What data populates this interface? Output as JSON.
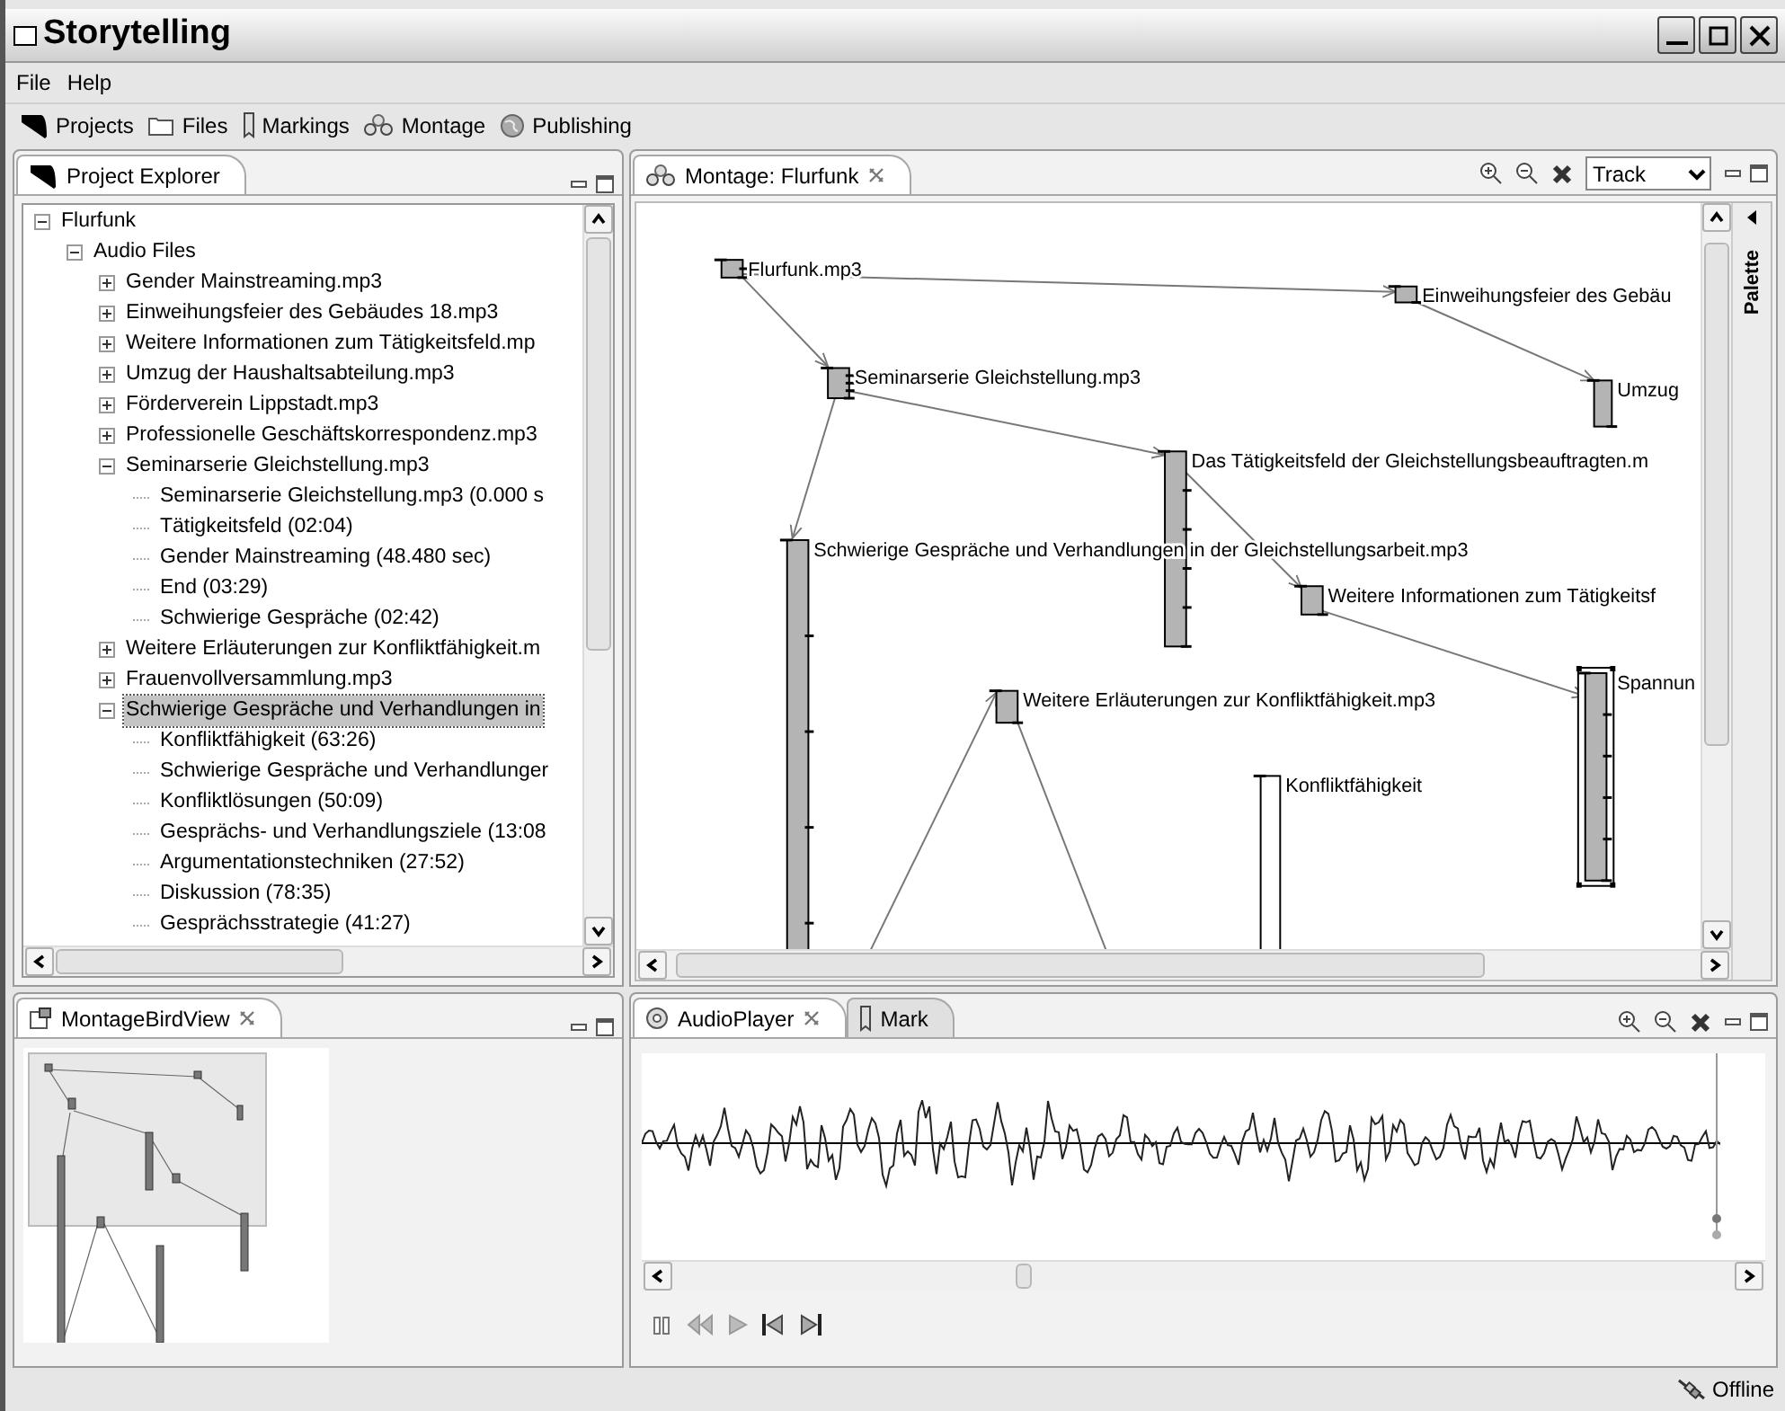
{
  "window": {
    "title": "Storytelling"
  },
  "menu": [
    "File",
    "Help"
  ],
  "toolbar": [
    {
      "label": "Projects",
      "kind": "projects"
    },
    {
      "label": "Files",
      "kind": "files"
    },
    {
      "label": "Markings",
      "kind": "markings"
    },
    {
      "label": "Montage",
      "kind": "montage"
    },
    {
      "label": "Publishing",
      "kind": "publishing"
    }
  ],
  "project_explorer": {
    "tab": {
      "label": "Project Explorer",
      "selected": true
    },
    "tree": [
      {
        "label": "Flurfunk",
        "expanded": true,
        "selected": false,
        "children": [
          {
            "label": "Audio Files",
            "expanded": true,
            "selected": false,
            "children": [
              {
                "label": "Gender Mainstreaming.mp3",
                "expanded": false,
                "selected": false
              },
              {
                "label": "Einweihungsfeier des Gebäudes 18.mp3",
                "expanded": false,
                "selected": false
              },
              {
                "label": "Weitere Informationen zum Tätigkeitsfeld.mp",
                "expanded": false,
                "selected": false
              },
              {
                "label": "Umzug der Haushaltsabteilung.mp3",
                "expanded": false,
                "selected": false
              },
              {
                "label": "Förderverein Lippstadt.mp3",
                "expanded": false,
                "selected": false
              },
              {
                "label": "Professionelle Geschäftskorrespondenz.mp3",
                "expanded": false,
                "selected": false
              },
              {
                "label": "Seminarserie Gleichstellung.mp3",
                "expanded": true,
                "selected": false,
                "children": [
                  {
                    "label": "Seminarserie Gleichstellung.mp3 (0.000 s",
                    "selected": false
                  },
                  {
                    "label": "Tätigkeitsfeld (02:04)",
                    "selected": false
                  },
                  {
                    "label": "Gender Mainstreaming (48.480 sec)",
                    "selected": false
                  },
                  {
                    "label": "End (03:29)",
                    "selected": false
                  },
                  {
                    "label": "Schwierige Gespräche (02:42)",
                    "selected": false
                  }
                ]
              },
              {
                "label": "Weitere Erläuterungen zur Konfliktfähigkeit.m",
                "expanded": false,
                "selected": false
              },
              {
                "label": "Frauenvollversammlung.mp3",
                "expanded": false,
                "selected": false
              },
              {
                "label": "Schwierige Gespräche und Verhandlungen in",
                "expanded": true,
                "selected": true,
                "children": [
                  {
                    "label": "Konfliktfähigkeit (63:26)",
                    "selected": false
                  },
                  {
                    "label": "Schwierige Gespräche und Verhandlunger",
                    "selected": false
                  },
                  {
                    "label": "Konfliktlösungen (50:09)",
                    "selected": false
                  },
                  {
                    "label": "Gesprächs- und Verhandlungsziele (13:08",
                    "selected": false
                  },
                  {
                    "label": "Argumentationstechniken (27:52)",
                    "selected": false
                  },
                  {
                    "label": "Diskussion (78:35)",
                    "selected": false
                  },
                  {
                    "label": "Gesprächsstrategie (41:27)",
                    "selected": false
                  }
                ]
              }
            ]
          }
        ]
      }
    ]
  },
  "montage": {
    "tab": {
      "label": "Montage: Flurfunk",
      "selected": true
    },
    "view_mode": "Track",
    "palette": "Palette",
    "nodes": [
      {
        "label": "Flurfunk.mp3",
        "kind": "audio",
        "selected": false
      },
      {
        "label": "Einweihungsfeier des Gebäu",
        "kind": "audio",
        "selected": false
      },
      {
        "label": "Seminarserie Gleichstellung.mp3",
        "kind": "audio",
        "selected": false
      },
      {
        "label": "Umzug",
        "kind": "audio",
        "selected": false
      },
      {
        "label": "Das Tätigkeitsfeld der Gleichstellungsbeauftragten.m",
        "kind": "audio",
        "selected": false
      },
      {
        "label": "Schwierige Gespräche und Verhandlungen in der Gleichstellungsarbeit.mp3",
        "kind": "audio",
        "selected": false
      },
      {
        "label": "Weitere Informationen zum Tätigkeitsf",
        "kind": "audio",
        "selected": false
      },
      {
        "label": "Spannun",
        "kind": "audio",
        "selected": true
      },
      {
        "label": "Weitere Erläuterungen zur Konfliktfähigkeit.mp3",
        "kind": "audio",
        "selected": false
      },
      {
        "label": "Konfliktfähigkeit",
        "kind": "mark",
        "selected": false
      }
    ]
  },
  "bird_view": {
    "tab": {
      "label": "MontageBirdView",
      "selected": true
    }
  },
  "audio_player": {
    "tabs": [
      {
        "label": "AudioPlayer",
        "selected": true
      },
      {
        "label": "Mark",
        "selected": false
      }
    ]
  },
  "status_bar": {
    "connection": "Offline"
  }
}
